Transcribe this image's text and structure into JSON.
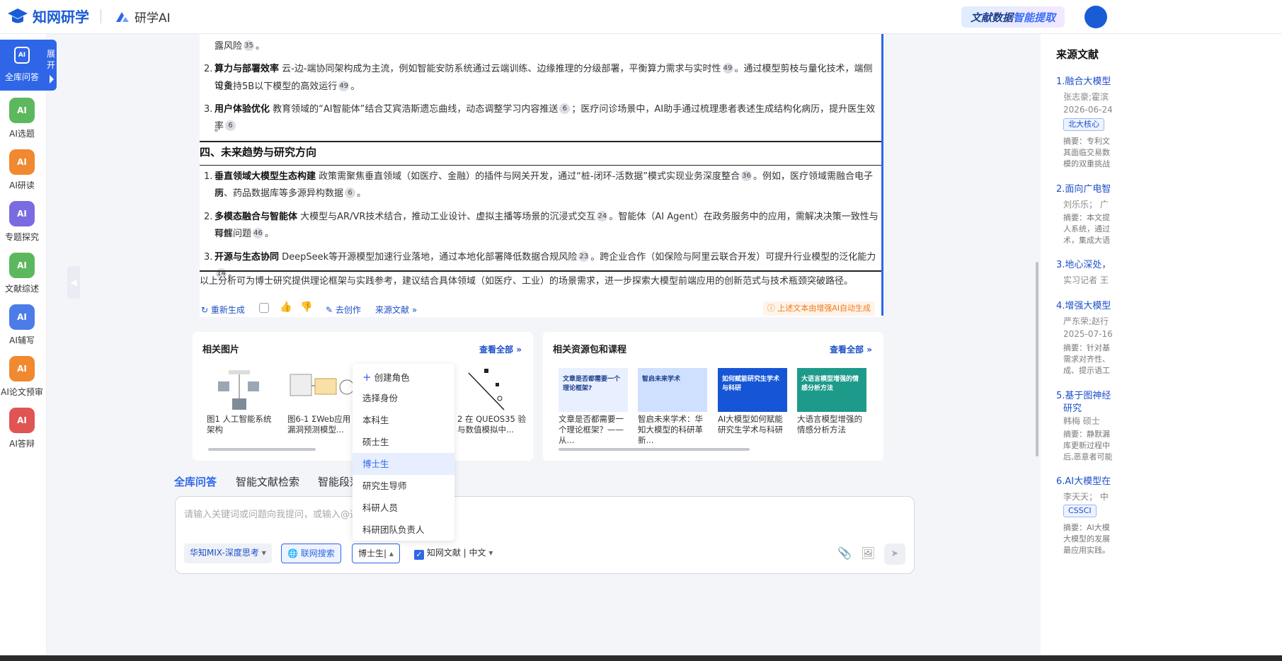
{
  "topbar": {
    "logo_text": "知网研学",
    "sub_logo": "研学AI",
    "promo_a": "文献数据",
    "promo_b": "智能提取"
  },
  "leftnav": {
    "active": {
      "icon": "AI",
      "label": "全库问答",
      "expand": "展开"
    },
    "items": [
      {
        "label": "AI选题",
        "color": "#5cb85c",
        "icon": "list-check-icon"
      },
      {
        "label": "AI研读",
        "color": "#f0892f",
        "icon": "book-ai-icon"
      },
      {
        "label": "专题探究",
        "color": "#7a6ce0",
        "icon": "folder-ai-icon"
      },
      {
        "label": "文献综述",
        "color": "#5cb85c",
        "icon": "doc-ai-icon"
      },
      {
        "label": "AI辅写",
        "color": "#4c7ce8",
        "icon": "pen-ai-icon"
      },
      {
        "label": "AI论文预审",
        "color": "#f0892f",
        "icon": "doc-search-icon"
      },
      {
        "label": "AI答辩",
        "color": "#e05454",
        "icon": "present-icon"
      }
    ]
  },
  "answer": {
    "line0": "露风险",
    "ref0": "35",
    "p2_bold": "算力与部署效率",
    "p2_text_a": "云-边-端协同架构成为主流，例如智能安防系统通过云端训练、边缘推理的分级部署，平衡算力需求与实时性",
    "p2_ref_a": "49",
    "p2_text_b": "。通过模型剪枝与量化技术，端侧设备",
    "p2_text_c": "可支持5B以下模型的高效运行",
    "p2_ref_b": "49",
    "p3_bold": "用户体验优化",
    "p3_text_a": "教育领域的“AI智能体”结合艾宾浩斯遗忘曲线，动态调整学习内容推送",
    "p3_ref_a": "6",
    "p3_text_b": "；医疗问诊场景中，AI助手通过梳理患者表述生成结构化病历，提升医生效率",
    "p3_ref_b": "6",
    "heading4": "四、未来趋势与研究方向",
    "f1_bold": "垂直领域大模型生态构建",
    "f1_text_a": "政策需聚焦垂直领域（如医疗、金融）的插件与网关开发，通过“桩-闭环-活数据”模式实现业务深度整合",
    "f1_ref_a": "36",
    "f1_text_b": "。例如，医疗领域需融合电子病",
    "f1_text_c": "历、药品数据库等多源异构数据",
    "f1_ref_b": "6",
    "f2_bold": "多模态融合与智能体",
    "f2_text_a": "大模型与AR/VR技术结合，推动工业设计、虚拟主播等场景的沉浸式交互",
    "f2_ref_a": "24",
    "f2_text_b": "。智能体（AI Agent）在政务服务中的应用，需解决决策一致性与可解",
    "f2_text_c": "释性问题",
    "f2_ref_b": "46",
    "f3_bold": "开源与生态协同",
    "f3_text_a": "DeepSeek等开源模型加速行业落地，通过本地化部署降低数据合规风险",
    "f3_ref_a": "23",
    "f3_text_b": "。跨企业合作（如保险与阿里云联合开发）可提升行业模型的泛化能力",
    "f3_ref_b": "14",
    "conclusion": "以上分析可为博士研究提供理论框架与实践参考，建议结合具体领域（如医疗、工业）的场景需求，进一步探索大模型前端应用的创新范式与技术瓶颈突破路径。",
    "regenerate": "重新生成",
    "create": "去创作",
    "source": "来源文献",
    "warning": "上述文本由增强AI自动生成"
  },
  "images_card": {
    "title": "相关图片",
    "more": "查看全部",
    "items": [
      {
        "caption": "图1 人工智能系统架构"
      },
      {
        "caption": "图6-1 ΣWeb应用漏洞预测模型..."
      },
      {
        "caption": "2 在 QUEOS35 验与数值模拟中..."
      }
    ]
  },
  "courses_card": {
    "title": "相关资源包和课程",
    "more": "查看全部",
    "items": [
      {
        "caption": "文章是否都需要一个理论框架？——从...",
        "thumb": "文章是否都需要一个理论框架?",
        "color": "#e8f0ff"
      },
      {
        "caption": "智启未来学术：华知大模型的科研革新...",
        "thumb": "智启未来学术",
        "color": "#cfe0ff"
      },
      {
        "caption": "AI大模型如何赋能研究生学术与科研",
        "thumb": "如何赋能研究生学术与科研",
        "color": "#1656d6"
      },
      {
        "caption": "大语言模型增强的情感分析方法",
        "thumb": "大语言模型增强的情感分析方法",
        "color": "#1d9a8a"
      }
    ]
  },
  "tabs": [
    "全库问答",
    "智能文献检索",
    "智能段落"
  ],
  "input": {
    "placeholder": "请输入关键词或问题向我提问，或输入@选",
    "model": "华知MIX-深度思考",
    "web_search": "联网搜索",
    "identity": "博士生",
    "scope": "知网文献 | 中文"
  },
  "dropdown": {
    "create": "创建角色",
    "header": "选择身份",
    "options": [
      "本科生",
      "硕士生",
      "博士生",
      "研究生导师",
      "科研人员",
      "科研团队负责人"
    ],
    "selected": "博士生"
  },
  "sources": {
    "title": "来源文献",
    "items": [
      {
        "title": "1.融合大模型",
        "meta": "张志豪;霍滨",
        "date": "2026-06-24",
        "tag": "北大核心",
        "abstract": [
          "摘要：专利文",
          "其面临交易数",
          "模的双重挑战"
        ]
      },
      {
        "title": "2.面向广电智",
        "meta": "刘乐乐；   广",
        "abstract": [
          "摘要：本文提",
          "人系统，通过",
          "术，集成大语"
        ]
      },
      {
        "title": "3.地心深处，",
        "meta": "实习记者 王"
      },
      {
        "title": "4.增强大模型",
        "meta": "严东荣;赵行",
        "date": "2025-07-16",
        "abstract": [
          "摘要：针对基",
          "需求对齐性、",
          "成、提示语工"
        ]
      },
      {
        "title": "5.基于图神经",
        "title2": "研究",
        "meta": "韩梅   硕士",
        "abstract": [
          "摘要：静默漏",
          "库更新过程中",
          "后,恶意者可能"
        ]
      },
      {
        "title": "6.AI大模型在",
        "meta": "李天天；   中",
        "tag": "CSSCI",
        "abstract": [
          "摘要：AI大模",
          "大模型的发展",
          "最应用实践。"
        ]
      }
    ]
  }
}
